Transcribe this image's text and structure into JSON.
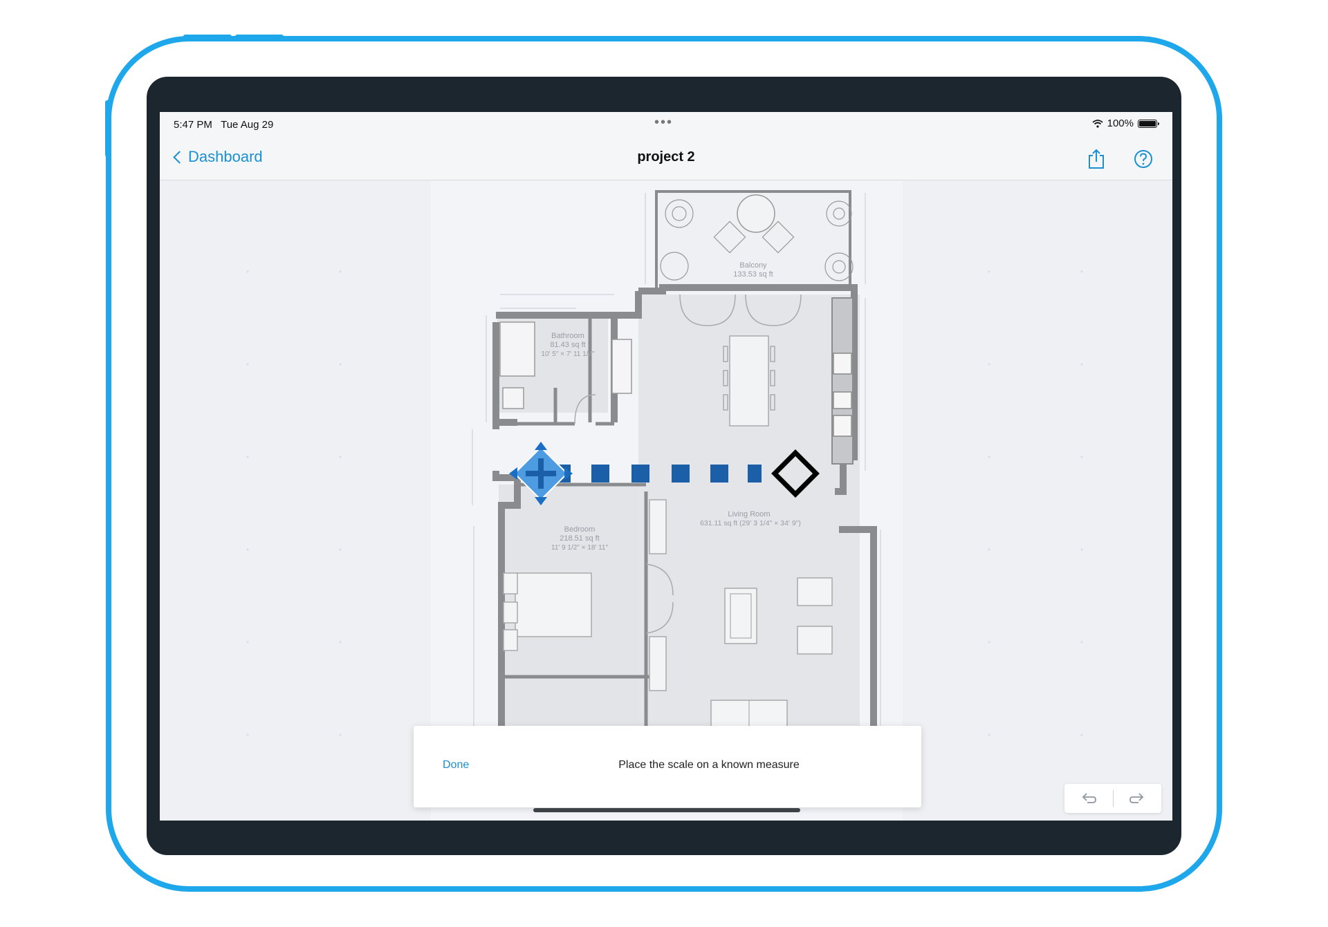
{
  "status_bar": {
    "time": "5:47 PM",
    "date": "Tue Aug 29",
    "battery": "100%",
    "dots": "•••"
  },
  "nav": {
    "back_label": "Dashboard",
    "title": "project 2",
    "share_icon": "share-icon",
    "help_icon": "help-icon"
  },
  "floor_plan": {
    "rooms": [
      {
        "name": "Balcony",
        "area": "133.53 sq ft",
        "dims": ""
      },
      {
        "name": "Bathroom",
        "area": "81.43 sq ft",
        "dims": "10' 5\" × 7' 11 1/4\""
      },
      {
        "name": "Bedroom",
        "area": "218.51 sq ft",
        "dims": "11' 9 1/2\" × 18' 11\""
      },
      {
        "name": "Living Room",
        "area": "631.11 sq ft (29' 3 1/4\" × 34' 9\")",
        "dims": ""
      }
    ],
    "colors": {
      "wall": "#8a8b8f",
      "scale_line": "#1a5fa8",
      "handle_fill": "#4a9ae0",
      "end_handle": "#000000"
    }
  },
  "toast": {
    "done_label": "Done",
    "message": "Place the scale on a known measure"
  },
  "controls": {
    "undo_icon": "undo-icon",
    "redo_icon": "redo-icon"
  }
}
